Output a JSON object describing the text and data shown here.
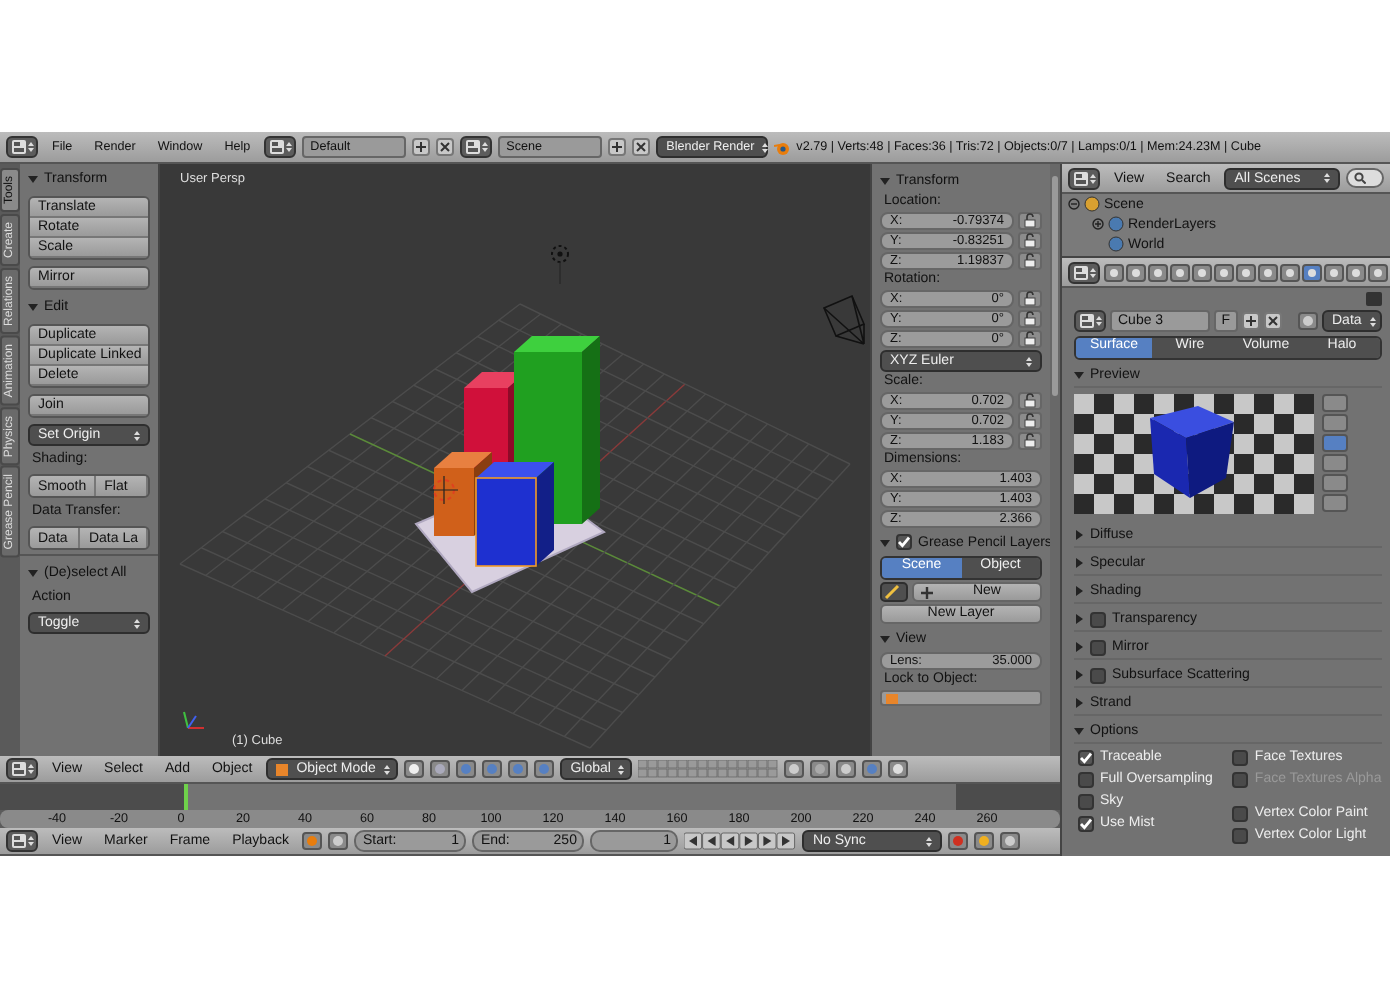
{
  "info_header": {
    "menus": [
      "File",
      "Render",
      "Window",
      "Help"
    ],
    "layout": "Default",
    "scene": "Scene",
    "engine": "Blender Render",
    "stats": "v2.79 | Verts:48 | Faces:36 | Tris:72 | Objects:0/7 | Lamps:0/1 | Mem:24.23M | Cube"
  },
  "tool_tabs": [
    {
      "label": "Tools",
      "selected": true
    },
    {
      "label": "Create",
      "selected": false
    },
    {
      "label": "Relations",
      "selected": false
    },
    {
      "label": "Animation",
      "selected": false
    },
    {
      "label": "Physics",
      "selected": false
    },
    {
      "label": "Grease Pencil",
      "selected": false
    }
  ],
  "tool_shelf": [
    {
      "kind": "header",
      "text": "Transform",
      "expanded": true
    },
    {
      "kind": "column",
      "labels": [
        "Translate",
        "Rotate",
        "Scale"
      ]
    },
    {
      "kind": "column",
      "labels": [
        "Mirror"
      ]
    },
    {
      "kind": "header",
      "text": "Edit",
      "expanded": true
    },
    {
      "kind": "column",
      "labels": [
        "Duplicate",
        "Duplicate Linked",
        "Delete"
      ]
    },
    {
      "kind": "column",
      "labels": [
        "Join"
      ]
    },
    {
      "kind": "dropdown",
      "text": "Set Origin"
    },
    {
      "kind": "label",
      "text": "Shading:"
    },
    {
      "kind": "row",
      "labels": [
        "Smooth",
        "Flat"
      ]
    },
    {
      "kind": "label",
      "text": "Data Transfer:"
    },
    {
      "kind": "row",
      "labels": [
        "Data",
        "Data La"
      ]
    }
  ],
  "operator_panel": {
    "title": "(De)select All",
    "expanded": true,
    "label": "Action",
    "value": "Toggle"
  },
  "viewport": {
    "view_name": "User Persp",
    "object_name": "(1) Cube"
  },
  "n_panel": [
    {
      "kind": "header",
      "text": "Transform",
      "expanded": true
    },
    {
      "kind": "label",
      "text": "Location:"
    },
    {
      "kind": "field",
      "axis": "X:",
      "value": "-0.79374",
      "lock": true
    },
    {
      "kind": "field",
      "axis": "Y:",
      "value": "-0.83251",
      "lock": true
    },
    {
      "kind": "field",
      "axis": "Z:",
      "value": "1.19837",
      "lock": true
    },
    {
      "kind": "label",
      "text": "Rotation:"
    },
    {
      "kind": "field",
      "axis": "X:",
      "value": "0°",
      "lock": true
    },
    {
      "kind": "field",
      "axis": "Y:",
      "value": "0°",
      "lock": true
    },
    {
      "kind": "field",
      "axis": "Z:",
      "value": "0°",
      "lock": true
    },
    {
      "kind": "dropdown",
      "text": "XYZ Euler"
    },
    {
      "kind": "label",
      "text": "Scale:"
    },
    {
      "kind": "field",
      "axis": "X:",
      "value": "0.702",
      "lock": true
    },
    {
      "kind": "field",
      "axis": "Y:",
      "value": "0.702",
      "lock": true
    },
    {
      "kind": "field",
      "axis": "Z:",
      "value": "1.183",
      "lock": true
    },
    {
      "kind": "label",
      "text": "Dimensions:"
    },
    {
      "kind": "field",
      "axis": "X:",
      "value": "1.403",
      "lock": false
    },
    {
      "kind": "field",
      "axis": "Y:",
      "value": "1.403",
      "lock": false
    },
    {
      "kind": "field",
      "axis": "Z:",
      "value": "2.366",
      "lock": false
    },
    {
      "kind": "check_header",
      "text": "Grease Pencil Layers",
      "checked": true
    },
    {
      "kind": "tabs",
      "tabs": [
        {
          "label": "Scene",
          "selected": true
        },
        {
          "label": "Object",
          "selected": false
        }
      ]
    },
    {
      "kind": "new_row",
      "text": "New"
    },
    {
      "kind": "button",
      "text": "New Layer"
    },
    {
      "kind": "header",
      "text": "View",
      "expanded": true
    },
    {
      "kind": "field",
      "axis": "Lens:",
      "value": "35.000",
      "lock": false
    },
    {
      "kind": "label",
      "text": "Lock to Object:"
    },
    {
      "kind": "object_field"
    }
  ],
  "outliner": {
    "menus": [
      "View",
      "Search"
    ],
    "filter": "All Scenes",
    "tree": [
      {
        "label": "Scene",
        "expanded": true,
        "children": [
          {
            "label": "RenderLayers",
            "expanded": false
          },
          {
            "label": "World"
          }
        ]
      }
    ]
  },
  "properties": {
    "context_tabs": [
      {
        "selected": false
      },
      {
        "selected": false
      },
      {
        "selected": false
      },
      {
        "selected": false
      },
      {
        "selected": false
      },
      {
        "selected": false
      },
      {
        "selected": false
      },
      {
        "selected": false
      },
      {
        "selected": false
      },
      {
        "selected": true
      },
      {
        "selected": false
      },
      {
        "selected": false
      },
      {
        "selected": false
      }
    ],
    "material": "Cube 3",
    "fake_user": "F",
    "link": "Data",
    "material_tabs": [
      {
        "label": "Surface",
        "selected": true
      },
      {
        "label": "Wire",
        "selected": false
      },
      {
        "label": "Volume",
        "selected": false
      },
      {
        "label": "Halo",
        "selected": false
      }
    ],
    "preview_shapes": [
      {
        "selected": false
      },
      {
        "selected": false
      },
      {
        "selected": true
      },
      {
        "selected": false
      },
      {
        "selected": false
      },
      {
        "selected": false
      }
    ],
    "panels": [
      {
        "title": "Preview",
        "expanded": true
      },
      {
        "title": "Diffuse",
        "expanded": false
      },
      {
        "title": "Specular",
        "expanded": false
      },
      {
        "title": "Shading",
        "expanded": false
      },
      {
        "title": "Transparency",
        "expanded": false,
        "checked": false
      },
      {
        "title": "Mirror",
        "expanded": false,
        "checked": false
      },
      {
        "title": "Subsurface Scattering",
        "expanded": false,
        "checked": false
      },
      {
        "title": "Strand",
        "expanded": false
      },
      {
        "title": "Options",
        "expanded": true
      }
    ],
    "options_left": [
      {
        "label": "Traceable",
        "checked": true,
        "disabled": false
      },
      {
        "label": "Full Oversampling",
        "checked": false,
        "disabled": false
      },
      {
        "label": "Sky",
        "checked": false,
        "disabled": false
      },
      {
        "label": "Use Mist",
        "checked": true,
        "disabled": false
      }
    ],
    "options_right": [
      {
        "label": "Face Textures",
        "checked": false,
        "disabled": false
      },
      {
        "label": "Face Textures Alpha",
        "checked": false,
        "disabled": true
      },
      {
        "label": "Vertex Color Paint",
        "checked": false,
        "disabled": false
      },
      {
        "label": "Vertex Color Light",
        "checked": false,
        "disabled": false
      }
    ]
  },
  "view3d_header": {
    "menus": [
      "View",
      "Select",
      "Add",
      "Object"
    ],
    "mode": "Object Mode",
    "orientation": "Global"
  },
  "timeline": {
    "ticks": [
      "-40",
      "-20",
      "0",
      "20",
      "40",
      "60",
      "80",
      "100",
      "120",
      "140",
      "160",
      "180",
      "200",
      "220",
      "240",
      "260"
    ],
    "playhead": {
      "level": 0.174
    }
  },
  "timeline_header": {
    "menus": [
      "View",
      "Marker",
      "Frame",
      "Playback"
    ],
    "start_label": "Start:",
    "start": "1",
    "end_label": "End:",
    "end": "250",
    "frame": "1",
    "sync": "No Sync"
  }
}
